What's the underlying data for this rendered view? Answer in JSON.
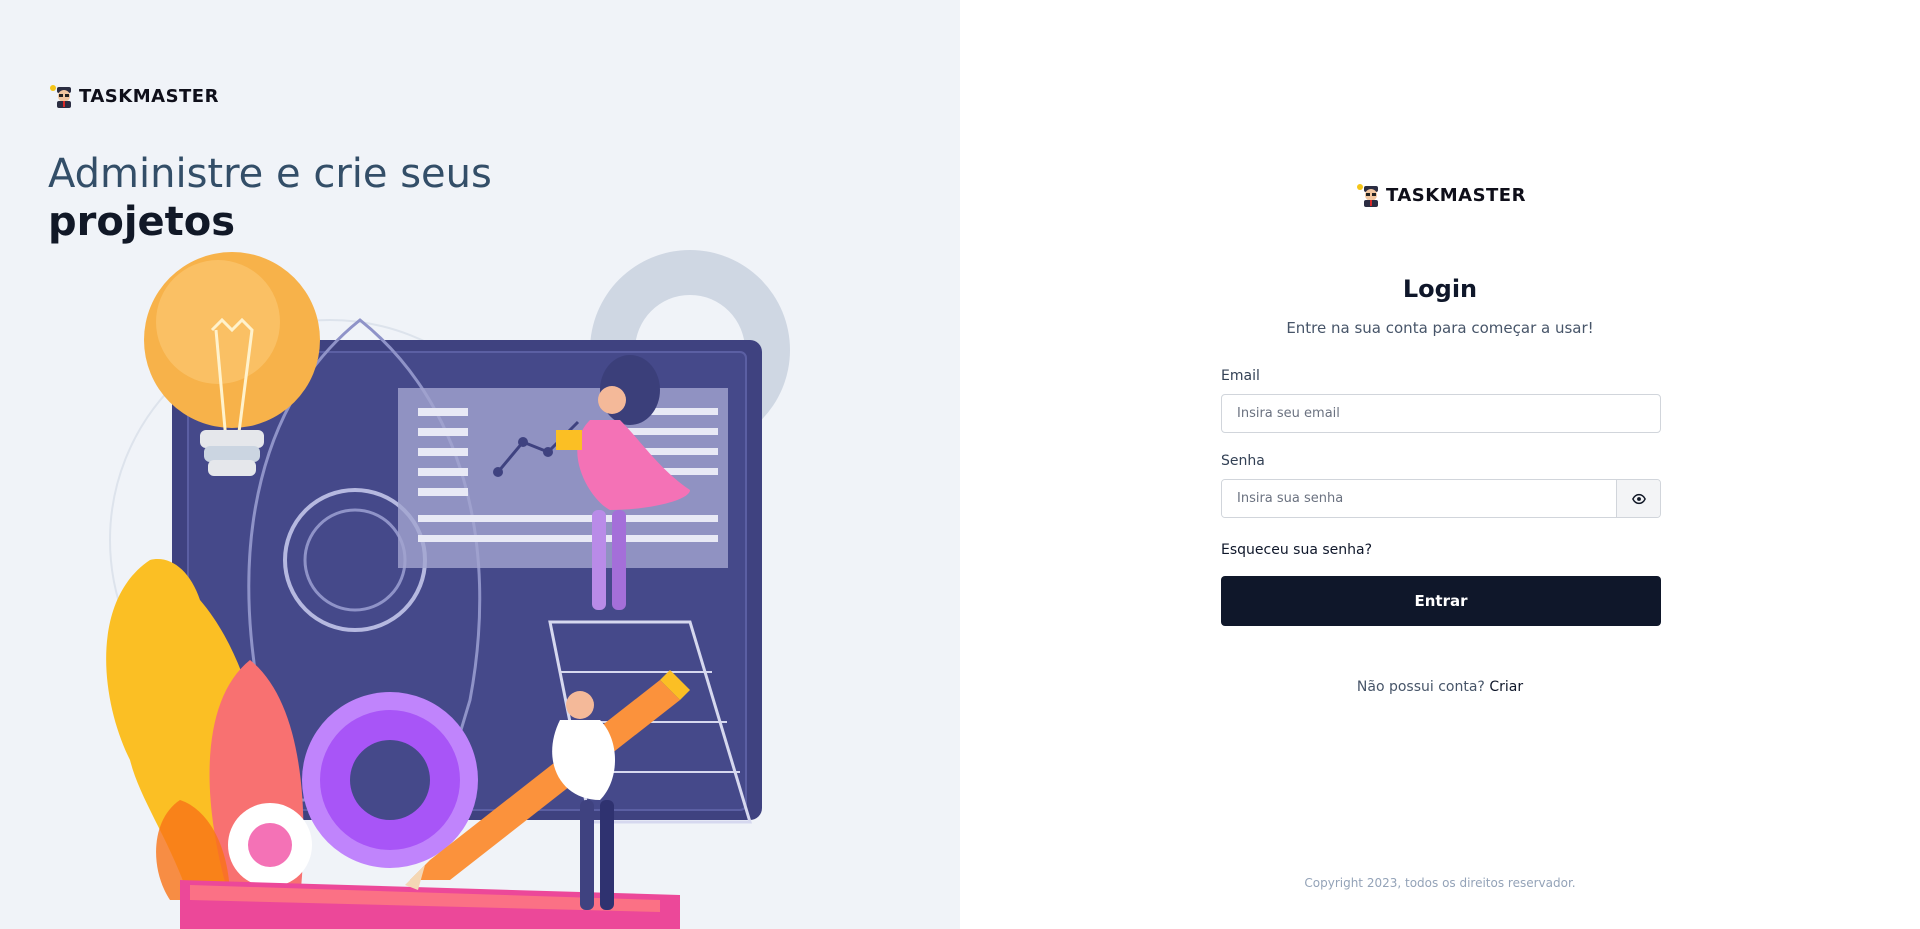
{
  "brand": {
    "name": "TASKMASTER"
  },
  "hero": {
    "line1": "Administre e crie seus",
    "line2": "projetos"
  },
  "login": {
    "title": "Login",
    "subtitle": "Entre na sua conta para começar a usar!",
    "email_label": "Email",
    "email_placeholder": "Insira seu email",
    "email_value": "",
    "password_label": "Senha",
    "password_placeholder": "Insira sua senha",
    "password_value": "",
    "show_password_icon": "eye-icon",
    "forgot_label": "Esqueceu sua senha?",
    "submit_label": "Entrar",
    "no_account_text": "Não possui conta?",
    "create_label": "Criar"
  },
  "footer": {
    "copyright": "Copyright 2023, todos os direitos reservador."
  },
  "colors": {
    "left_background": "#f0f3f8",
    "primary": "#0f172a",
    "monitor": "#3f4280",
    "accent_pink": "#f472b6",
    "accent_orange": "#f59e0b",
    "accent_purple": "#a855f7"
  }
}
